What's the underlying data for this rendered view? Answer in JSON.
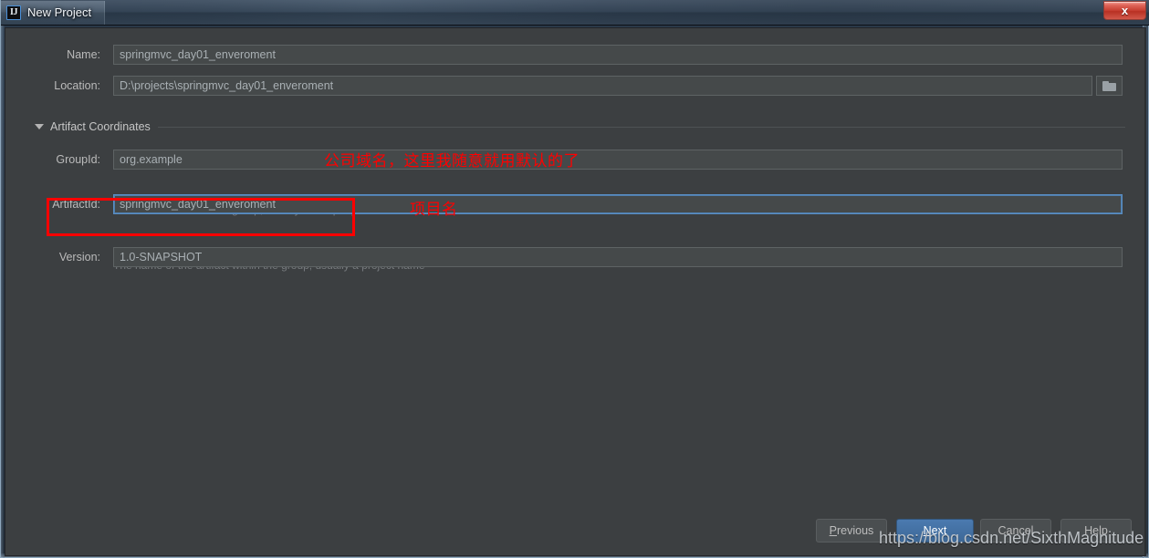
{
  "window": {
    "title": "New Project",
    "app_icon": "intellij-idea-icon",
    "close_label": "x"
  },
  "form": {
    "name": {
      "label": "Name:",
      "value": "springmvc_day01_enveroment",
      "placeholder": ""
    },
    "location": {
      "label": "Location:",
      "value": "D:\\projects\\springmvc_day01_enveroment",
      "placeholder": "",
      "browse_icon": "folder-icon"
    },
    "section": {
      "title": "Artifact Coordinates",
      "expanded": true,
      "collapse_icon": "triangle-down-icon"
    },
    "group_id": {
      "label": "GroupId:",
      "value": "org.example",
      "hint": "The name of the artifact group, usually a company domain"
    },
    "artifact_id": {
      "label": "ArtifactId:",
      "value": "springmvc_day01_enveroment",
      "hint": "The name of the artifact within the group, usually a project name",
      "focused": true
    },
    "version": {
      "label": "Version:",
      "value": "1.0-SNAPSHOT"
    }
  },
  "buttons": {
    "previous": {
      "label": "Previous",
      "mnemonic": "P"
    },
    "next": {
      "label": "Next",
      "mnemonic": "N",
      "primary": true
    },
    "cancel": {
      "label": "Cancel"
    },
    "help": {
      "label": "Help"
    }
  },
  "annotations": {
    "group_id_note": "公司域名，这里我随意就用默认的了",
    "artifact_id_note": "项目名",
    "highlight_color": "#ff0000"
  },
  "watermark": {
    "text": "https://blog.csdn.net/SixthMagnitude"
  },
  "colors": {
    "dialog_background": "#3c3f41",
    "input_background": "#45494a",
    "focus_border": "#5a8ec4",
    "primary_button": "#3d6897",
    "label_text": "#bbbbbb",
    "hint_text": "#777b7e"
  }
}
